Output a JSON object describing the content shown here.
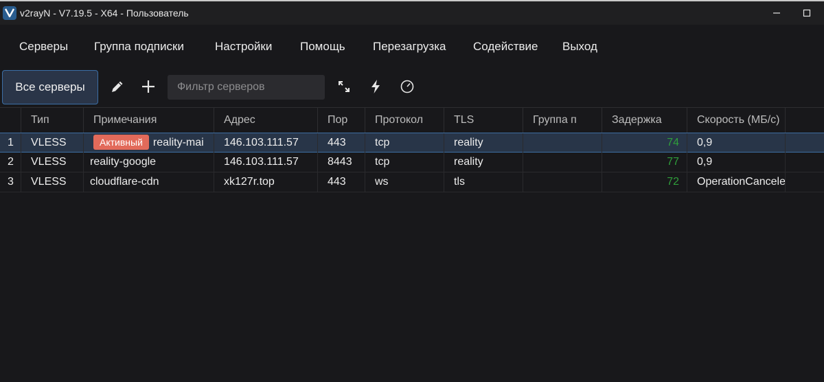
{
  "window": {
    "title": "v2rayN - V7.19.5 - X64 - Пользователь"
  },
  "menu": [
    "Серверы",
    "Группа подписки",
    "Настройки",
    "Помощь",
    "Перезагрузка",
    "Содействие",
    "Выход"
  ],
  "toolbar": {
    "all_servers_label": "Все серверы",
    "filter_placeholder": "Фильтр серверов",
    "icons": [
      "edit-icon",
      "add-icon",
      "expand-icon",
      "flash-icon",
      "speedometer-icon"
    ]
  },
  "table": {
    "columns": [
      "Тип",
      "Примечания",
      "Адрес",
      "Пор",
      "Протокол",
      "TLS",
      "Группа п",
      "Задержка",
      "Скорость (МБ/с)"
    ],
    "rows": [
      {
        "num": "1",
        "type": "VLESS",
        "badge": "Активный",
        "remark": "reality-mai",
        "address": "146.103.111.57",
        "port": "443",
        "protocol": "tcp",
        "tls": "reality",
        "group": "",
        "latency": "74",
        "speed": "0,9"
      },
      {
        "num": "2",
        "type": "VLESS",
        "badge": "",
        "remark": "reality-google",
        "address": "146.103.111.57",
        "port": "8443",
        "protocol": "tcp",
        "tls": "reality",
        "group": "",
        "latency": "77",
        "speed": "0,9"
      },
      {
        "num": "3",
        "type": "VLESS",
        "badge": "",
        "remark": "cloudflare-cdn",
        "address": "xk127r.top",
        "port": "443",
        "protocol": "ws",
        "tls": "tls",
        "group": "",
        "latency": "72",
        "speed": "OperationCanceled"
      }
    ]
  },
  "colors": {
    "background": "#18181b",
    "selected_row": "#283548",
    "accent_border": "#3c6fa6",
    "badge": "#e26a5a",
    "latency_text": "#2f9e3b"
  }
}
